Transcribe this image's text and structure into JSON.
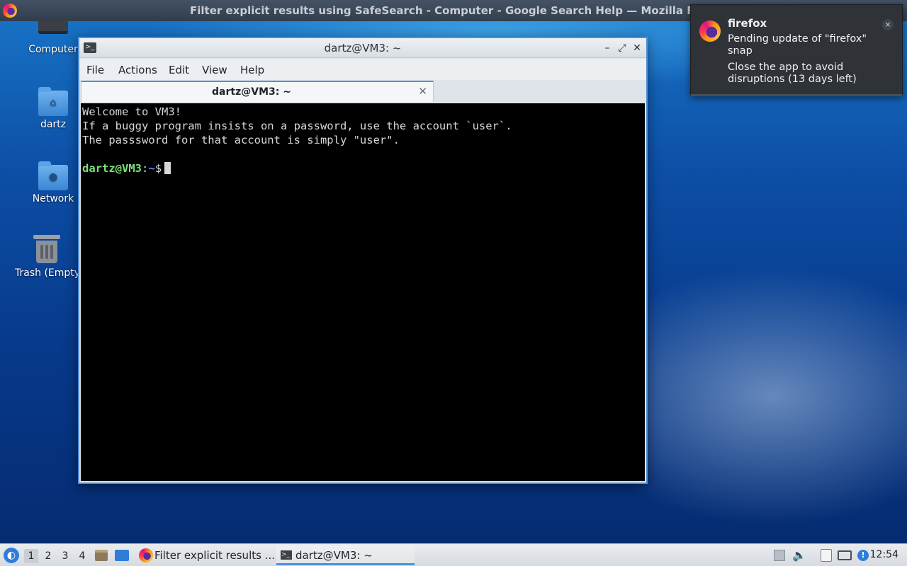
{
  "topbar": {
    "title": "Filter explicit results using SafeSearch - Computer - Google Search Help — Mozilla Firefox"
  },
  "desktop": {
    "icons": [
      {
        "label": "Computer",
        "icon": "computer-icon"
      },
      {
        "label": "dartz",
        "icon": "home-folder-icon"
      },
      {
        "label": "Network",
        "icon": "network-folder-icon"
      },
      {
        "label": "Trash (Empty)",
        "icon": "trash-icon"
      }
    ]
  },
  "terminal": {
    "window_title": "dartz@VM3: ~",
    "menu": [
      "File",
      "Actions",
      "Edit",
      "View",
      "Help"
    ],
    "tab_title": "dartz@VM3: ~",
    "output": [
      "Welcome to VM3!",
      "If a buggy program insists on a password, use the account `user`.",
      "The passsword for that account is simply \"user\"."
    ],
    "prompt_user": "dartz@VM3",
    "prompt_sep": ":",
    "prompt_path": "~",
    "prompt_symbol": "$"
  },
  "notification": {
    "app": "firefox",
    "summary": "Pending update of \"firefox\" snap",
    "body": "Close the app to avoid disruptions (13 days left)",
    "close_glyph": "×"
  },
  "taskbar": {
    "workspaces": [
      "1",
      "2",
      "3",
      "4"
    ],
    "tasks": [
      {
        "label": "Filter explicit results ...",
        "icon": "firefox-icon"
      },
      {
        "label": "dartz@VM3: ~",
        "icon": "terminal-icon"
      }
    ],
    "clock": "12:54"
  },
  "colors": {
    "accent": "#4f8fd9",
    "prompt_user": "#7fe07a",
    "prompt_path": "#6d86ff"
  }
}
